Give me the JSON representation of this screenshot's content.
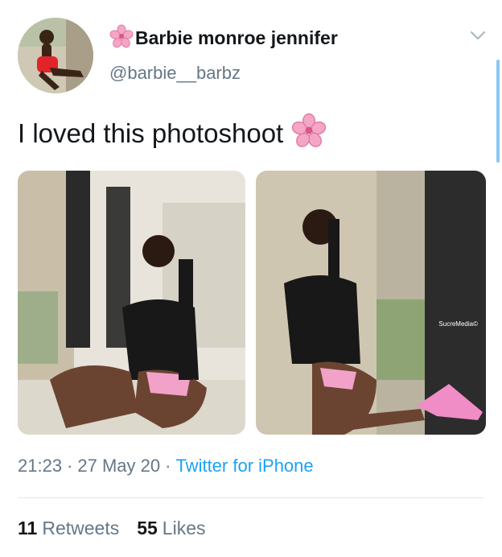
{
  "user": {
    "display_name": "Barbie monroe jennifer",
    "handle": "@barbie__barbz",
    "avatar_icon": "profile-photo",
    "name_emoji_icon": "cherry-blossom-icon"
  },
  "tweet": {
    "text": "I loved this photoshoot",
    "emoji_icon": "cherry-blossom-icon",
    "photos": [
      {
        "icon": "photo-image"
      },
      {
        "icon": "photo-image",
        "watermark": "SucreMedia©"
      }
    ]
  },
  "meta": {
    "time": "21:23",
    "separator": "·",
    "date": "27 May 20",
    "source": "Twitter for iPhone"
  },
  "stats": {
    "retweets_count": "11",
    "retweets_label": "Retweets",
    "likes_count": "55",
    "likes_label": "Likes"
  },
  "colors": {
    "accent": "#1da1f2",
    "secondary_text": "#657786",
    "primary_text": "#14171a",
    "emoji_pink": "#f4a7c4"
  }
}
